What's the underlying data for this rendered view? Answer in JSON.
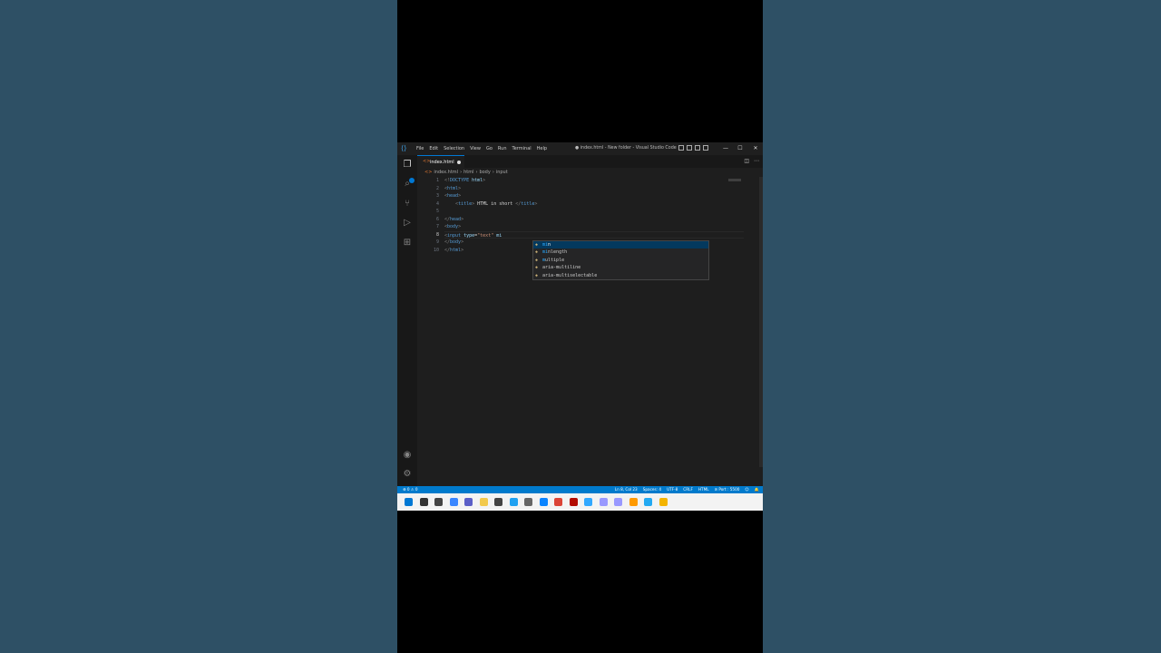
{
  "window": {
    "menu": [
      "File",
      "Edit",
      "Selection",
      "View",
      "Go",
      "Run",
      "Terminal",
      "Help"
    ],
    "title": "● index.html - New folder - Visual Studio Code",
    "minimize": "—",
    "maximize": "☐",
    "close": "✕"
  },
  "tab": {
    "label": "index.html",
    "icon": "html-file-icon"
  },
  "breadcrumb": [
    "index.html",
    "html",
    "body",
    "input"
  ],
  "editor": {
    "line_numbers": [
      "1",
      "2",
      "3",
      "4",
      "5",
      "6",
      "7",
      "8",
      "9",
      "10"
    ],
    "current_line": "8",
    "lines": [
      [
        {
          "c": "b",
          "t": "<!"
        },
        {
          "c": "t",
          "t": "DOCTYPE"
        },
        {
          "c": "a",
          "t": " html"
        },
        {
          "c": "b",
          "t": ">"
        }
      ],
      [
        {
          "c": "b",
          "t": "<"
        },
        {
          "c": "t",
          "t": "html"
        },
        {
          "c": "b",
          "t": ">"
        }
      ],
      [
        {
          "c": "b",
          "t": "<"
        },
        {
          "c": "t",
          "t": "head"
        },
        {
          "c": "b",
          "t": ">"
        }
      ],
      [
        {
          "c": "w",
          "t": "    "
        },
        {
          "c": "b",
          "t": "<"
        },
        {
          "c": "t",
          "t": "title"
        },
        {
          "c": "b",
          "t": ">"
        },
        {
          "c": "w",
          "t": " HTML in short "
        },
        {
          "c": "b",
          "t": "</"
        },
        {
          "c": "t",
          "t": "title"
        },
        {
          "c": "b",
          "t": ">"
        }
      ],
      [],
      [
        {
          "c": "b",
          "t": "</"
        },
        {
          "c": "t",
          "t": "head"
        },
        {
          "c": "b",
          "t": ">"
        }
      ],
      [
        {
          "c": "b",
          "t": "<"
        },
        {
          "c": "t",
          "t": "body"
        },
        {
          "c": "b",
          "t": ">"
        }
      ],
      [
        {
          "c": "b",
          "t": "<"
        },
        {
          "c": "t",
          "t": "input"
        },
        {
          "c": "a",
          "t": " type"
        },
        {
          "c": "w",
          "t": "="
        },
        {
          "c": "s",
          "t": "\"text\""
        },
        {
          "c": "a",
          "t": " mi"
        }
      ],
      [
        {
          "c": "b",
          "t": "</"
        },
        {
          "c": "t",
          "t": "body"
        },
        {
          "c": "b",
          "t": ">"
        }
      ],
      [
        {
          "c": "b",
          "t": "</"
        },
        {
          "c": "t",
          "t": "html"
        },
        {
          "c": "b",
          "t": ">"
        }
      ]
    ]
  },
  "suggestions": [
    {
      "match": "mi",
      "rest": "n"
    },
    {
      "match": "mi",
      "rest": "nlength"
    },
    {
      "match": "m",
      "rest": "ultiple"
    },
    {
      "match": "",
      "rest": "aria-multiline"
    },
    {
      "match": "",
      "rest": "aria-multiselectable"
    }
  ],
  "status": {
    "left": "⊗ 0 ⚠ 0",
    "ln_col": "Ln 8, Col 23",
    "spaces": "Spaces: 4",
    "encoding": "UTF-8",
    "eol": "CRLF",
    "language": "HTML",
    "port": "⊘ Port : 5500",
    "feedback": "☺",
    "bell": "🔔"
  },
  "colors": {
    "accent": "#007acc",
    "tag": "#569cd6",
    "attribute": "#9cdcfe",
    "string": "#ce9178",
    "bracket": "#808080"
  },
  "taskbar_icons": [
    "windows-start",
    "search",
    "file-explorer",
    "widgets",
    "chat",
    "file-manager",
    "store",
    "edge",
    "settings",
    "photos",
    "chrome",
    "acrobat",
    "photoshop",
    "premiere",
    "after-effects",
    "illustrator",
    "vscode",
    "chrome-canary"
  ]
}
